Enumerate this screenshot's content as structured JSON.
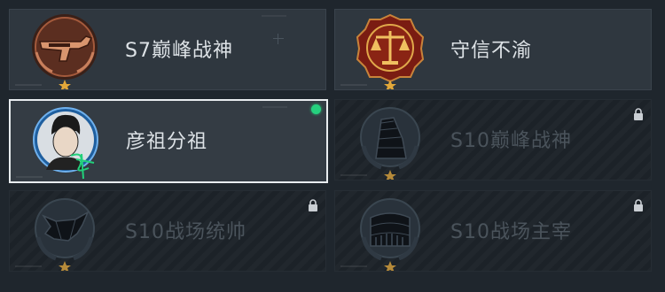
{
  "badges": [
    {
      "title": "S7巅峰战神",
      "icon": "bronze-gun-emblem-icon",
      "locked": false,
      "selected": false
    },
    {
      "title": "守信不渝",
      "icon": "scales-of-justice-emblem-icon",
      "locked": false,
      "selected": false
    },
    {
      "title": "彦祖分祖",
      "icon": "celebrity-portrait-signature-icon",
      "locked": false,
      "selected": true
    },
    {
      "title": "S10巅峰战神",
      "icon": "tower-building-emblem-icon",
      "locked": true,
      "selected": false
    },
    {
      "title": "S10战场统帅",
      "icon": "aircraft-emblem-icon",
      "locked": true,
      "selected": false
    },
    {
      "title": "S10战场主宰",
      "icon": "colosseum-emblem-icon",
      "locked": true,
      "selected": false
    }
  ],
  "colors": {
    "selected_dot": "#25d07e",
    "star": "#e2a83a",
    "card_bg": "#2f373f",
    "locked_bg": "#1c2228"
  }
}
